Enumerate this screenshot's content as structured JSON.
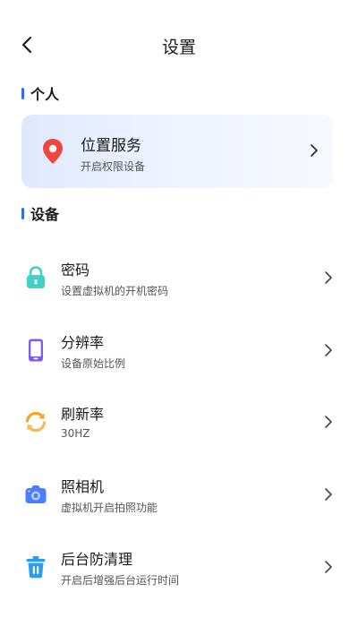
{
  "header": {
    "title": "设置"
  },
  "sections": {
    "personal": "个人",
    "device": "设备"
  },
  "location": {
    "title": "位置服务",
    "subtitle": "开启权限设备"
  },
  "items": [
    {
      "title": "密码",
      "subtitle": "设置虚拟机的开机密码",
      "icon": "lock-icon"
    },
    {
      "title": "分辨率",
      "subtitle": "设备原始比例",
      "icon": "phone-icon"
    },
    {
      "title": "刷新率",
      "subtitle": "30HZ",
      "icon": "refresh-icon"
    },
    {
      "title": "照相机",
      "subtitle": "虚拟机开启拍照功能",
      "icon": "camera-icon"
    },
    {
      "title": "后台防清理",
      "subtitle": "开启后增强后台运行时间",
      "icon": "trash-icon"
    }
  ],
  "colors": {
    "accent": "#2f6bff",
    "location_pin": "#f0463f",
    "lock": "#3ed2c8",
    "phone": "#7e5bef",
    "refresh": "#f5a623",
    "camera": "#4a7dff",
    "trash": "#2a9cf5"
  }
}
